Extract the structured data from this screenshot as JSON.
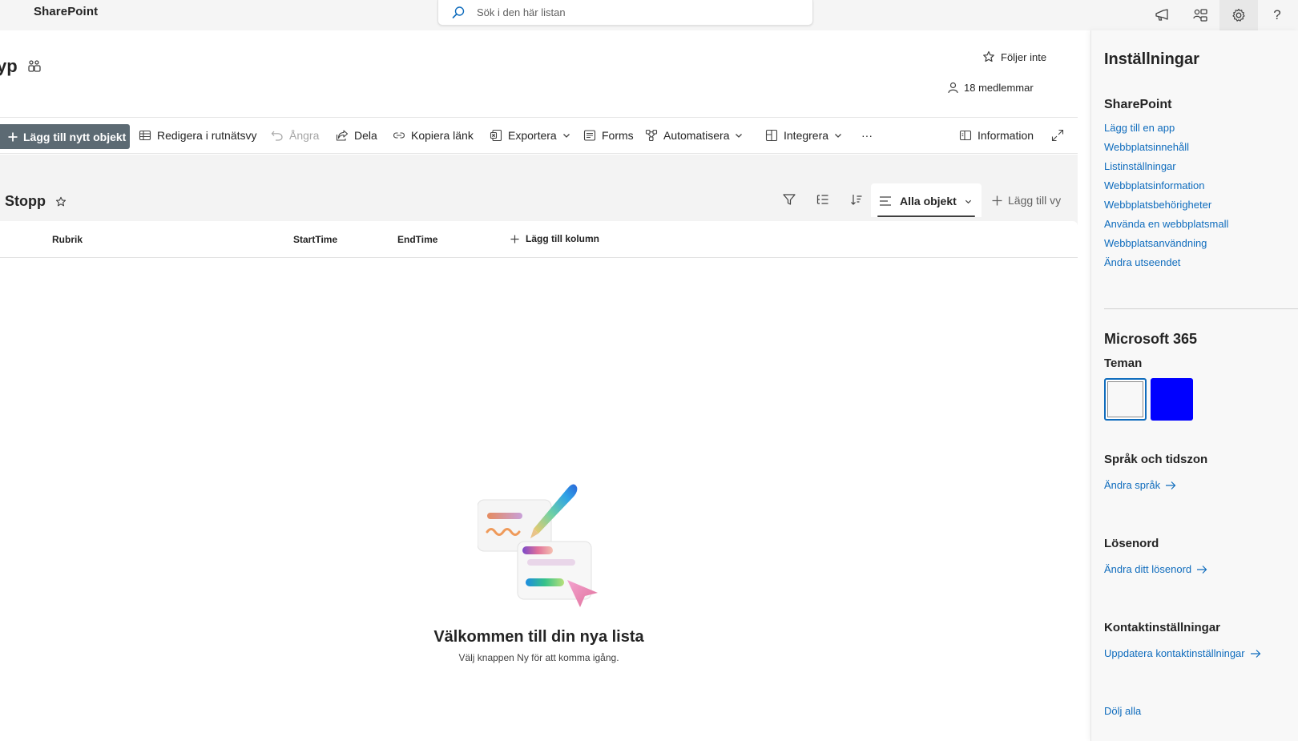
{
  "suitebar": {
    "brand": "SharePoint",
    "search_placeholder": "Sök i den här listan"
  },
  "header": {
    "site_title_fragment": "yp",
    "follow_label": "Följer inte",
    "members_label": "18 medlemmar"
  },
  "commandbar": {
    "new_item": "Lägg till nytt objekt",
    "edit_grid": "Redigera i rutnätsvy",
    "undo": "Ångra",
    "share": "Dela",
    "copy_link": "Kopiera länk",
    "export": "Exportera",
    "forms": "Forms",
    "automate": "Automatisera",
    "integrate": "Integrera",
    "more": "···",
    "info": "Information"
  },
  "view": {
    "list_name": "Stopp",
    "current_view": "Alla objekt",
    "add_view": "Lägg till vy"
  },
  "columns": {
    "title": "Rubrik",
    "start": "StartTime",
    "end": "EndTime",
    "add": "Lägg till kolumn"
  },
  "empty_state": {
    "title": "Välkommen till din nya lista",
    "subtitle": "Välj knappen Ny för att komma igång."
  },
  "settings_panel": {
    "title": "Inställningar",
    "sharepoint_heading": "SharePoint",
    "sharepoint_links": [
      "Lägg till en app",
      "Webbplatsinnehåll",
      "Listinställningar",
      "Webbplatsinformation",
      "Webbplatsbehörigheter",
      "Använda en webbplatsmall",
      "Webbplatsanvändning",
      "Ändra utseendet"
    ],
    "m365_heading": "Microsoft 365",
    "themes_heading": "Teman",
    "theme_colors": [
      "#f8f8f8",
      "#0000ff"
    ],
    "language_heading": "Språk och tidszon",
    "language_link": "Ändra språk",
    "password_heading": "Lösenord",
    "password_link": "Ändra ditt lösenord",
    "contact_heading": "Kontaktinställningar",
    "contact_link": "Uppdatera kontaktinställningar",
    "hide_all": "Dölj alla"
  },
  "colors": {
    "link": "#0f6cbd",
    "primary_button": "#5c6a73",
    "canvas": "#f3f3f3"
  }
}
